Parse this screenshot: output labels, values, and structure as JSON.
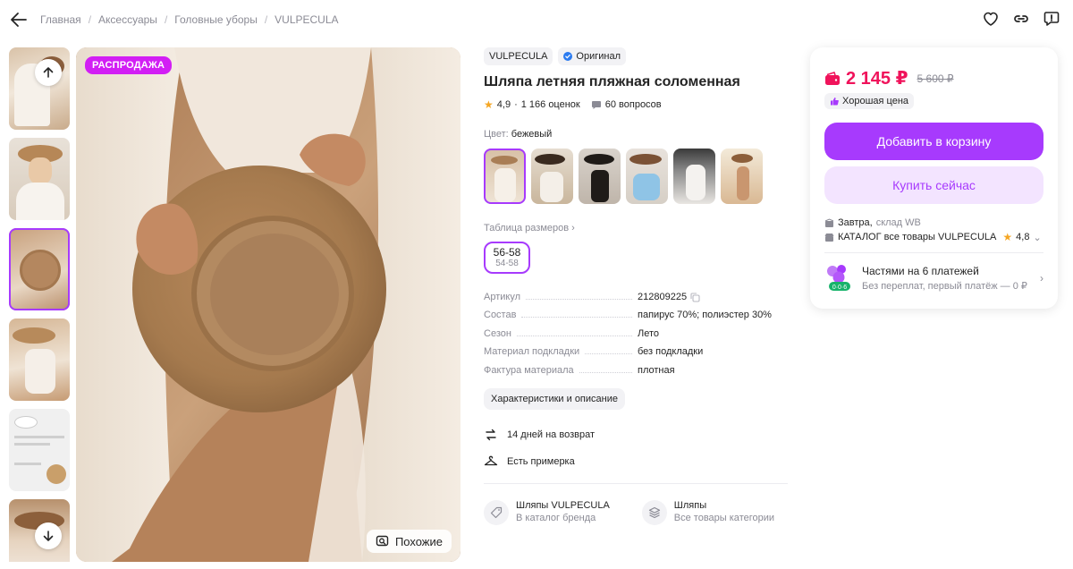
{
  "breadcrumbs": [
    "Главная",
    "Аксессуары",
    "Головные уборы",
    "VULPECULA"
  ],
  "icons": {
    "back": "arrow-left-icon",
    "favorite": "heart-icon",
    "share": "link-icon",
    "report": "report-icon",
    "up": "arrow-up-icon",
    "down": "arrow-down-icon",
    "similar": "similar-search-icon"
  },
  "gallery": {
    "sale_badge": "РАСПРОДАЖА",
    "similar_label": "Похожие"
  },
  "product": {
    "brand": "VULPECULA",
    "original_label": "Оригинал",
    "title": "Шляпа летняя пляжная соломенная",
    "rating": "4,9",
    "reviews": "1 166 оценок",
    "questions": "60 вопросов",
    "color_label": "Цвет:",
    "color_value": "бежевый",
    "size_table_label": "Таблица размеров",
    "size_main": "56-58",
    "size_sub": "54-58",
    "specs": [
      {
        "key": "Артикул",
        "value": "212809225"
      },
      {
        "key": "Состав",
        "value": "папирус 70%; полиэстер 30%"
      },
      {
        "key": "Сезон",
        "value": "Лето"
      },
      {
        "key": "Материал подкладки",
        "value": "без подкладки"
      },
      {
        "key": "Фактура материала",
        "value": "плотная"
      }
    ],
    "characteristics_button": "Характеристики и описание",
    "features": [
      "14 дней на возврат",
      "Есть примерка"
    ],
    "categories": [
      {
        "title": "Шляпы VULPECULA",
        "subtitle": "В каталог бренда"
      },
      {
        "title": "Шляпы",
        "subtitle": "Все товары категории"
      }
    ]
  },
  "buy_card": {
    "price": "2 145 ₽",
    "old_price": "5 600 ₽",
    "good_price": "Хорошая цена",
    "add_to_cart": "Добавить в корзину",
    "buy_now": "Купить сейчас",
    "delivery_day": "Завтра,",
    "delivery_warehouse": "склад WB",
    "seller_label": "КАТАЛОГ все товары VULPECULA",
    "seller_rating": "4,8",
    "installments_title": "Частями на 6 платежей",
    "installments_sub": "Без переплат, первый платёж — 0 ₽",
    "installments_badge": "0·0·6"
  },
  "colors": {
    "accent": "#a73afd",
    "price": "#f0135b",
    "sale": "#d21ef4"
  }
}
